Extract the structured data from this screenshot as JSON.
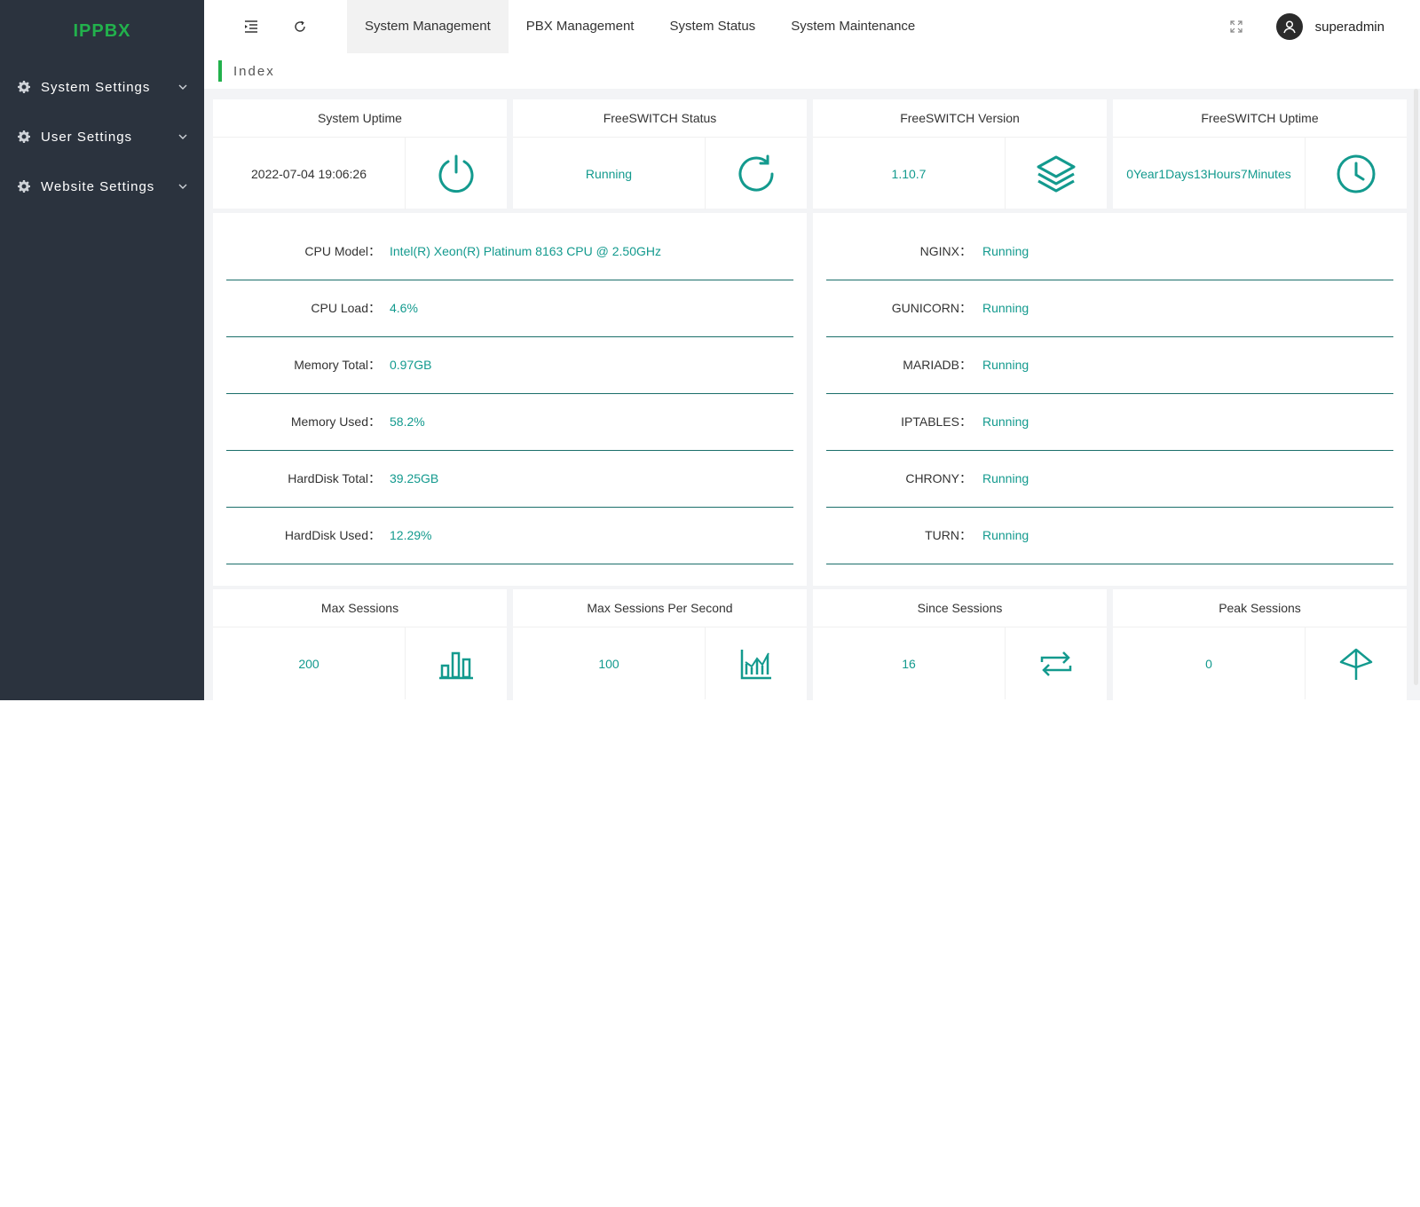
{
  "sidebar": {
    "logo": "IPPBX",
    "items": [
      {
        "label": "System Settings"
      },
      {
        "label": "User Settings"
      },
      {
        "label": "Website Settings"
      }
    ]
  },
  "topbar": {
    "nav": [
      {
        "label": "System Management",
        "active": true
      },
      {
        "label": "PBX Management"
      },
      {
        "label": "System Status"
      },
      {
        "label": "System Maintenance"
      }
    ],
    "username": "superadmin"
  },
  "breadcrumb": {
    "label": "Index"
  },
  "stats_top": [
    {
      "title": "System Uptime",
      "value": "2022-07-04 19:06:26",
      "icon": "power-icon"
    },
    {
      "title": "FreeSWITCH Status",
      "value": "Running",
      "icon": "refresh-icon"
    },
    {
      "title": "FreeSWITCH Version",
      "value": "1.10.7",
      "icon": "layers-icon"
    },
    {
      "title": "FreeSWITCH Uptime",
      "value": "0Year1Days13Hours7Minutes",
      "icon": "clock-icon"
    }
  ],
  "system_info": [
    {
      "label": "CPU Model",
      "value": "Intel(R) Xeon(R) Platinum 8163 CPU @ 2.50GHz"
    },
    {
      "label": "CPU Load",
      "value": "4.6%"
    },
    {
      "label": "Memory Total",
      "value": "0.97GB"
    },
    {
      "label": "Memory Used",
      "value": "58.2%"
    },
    {
      "label": "HardDisk Total",
      "value": "39.25GB"
    },
    {
      "label": "HardDisk Used",
      "value": "12.29%"
    }
  ],
  "services": [
    {
      "label": "NGINX",
      "value": "Running"
    },
    {
      "label": "GUNICORN",
      "value": "Running"
    },
    {
      "label": "MARIADB",
      "value": "Running"
    },
    {
      "label": "IPTABLES",
      "value": "Running"
    },
    {
      "label": "CHRONY",
      "value": "Running"
    },
    {
      "label": "TURN",
      "value": "Running"
    }
  ],
  "colon": "：",
  "stats_bottom": [
    {
      "title": "Max Sessions",
      "value": "200",
      "icon": "bar-chart-icon"
    },
    {
      "title": "Max Sessions Per Second",
      "value": "100",
      "icon": "line-chart-icon"
    },
    {
      "title": "Since Sessions",
      "value": "16",
      "icon": "repeat-icon"
    },
    {
      "title": "Peak Sessions",
      "value": "0",
      "icon": "peak-icon"
    }
  ],
  "colors": {
    "accent": "#22b14c",
    "teal": "#139a8e",
    "sidebar": "#2b333e"
  }
}
